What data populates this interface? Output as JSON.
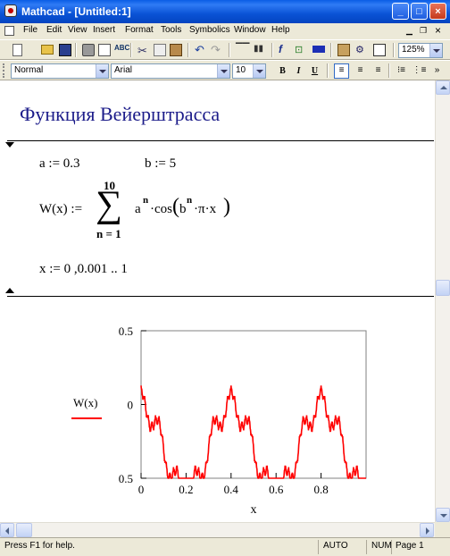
{
  "window": {
    "title": "Mathcad - [Untitled:1]",
    "buttons": {
      "minimize": "_",
      "maximize": "□",
      "close": "×"
    }
  },
  "menu": [
    "File",
    "Edit",
    "View",
    "Insert",
    "Format",
    "Tools",
    "Symbolics",
    "Window",
    "Help"
  ],
  "toolbar": {
    "zoom": "125%"
  },
  "format_toolbar": {
    "style": "Normal",
    "font": "Arial",
    "size": "10",
    "bold": "B",
    "italic": "I",
    "underline": "U"
  },
  "document": {
    "heading": "Функция Вейерштрасса",
    "def_a": "a := 0.3",
    "def_b": "b := 5",
    "w_def": {
      "lhs": "W(x) :=",
      "sum_upper": "10",
      "sum_lower": "n = 1",
      "sigma": "∑",
      "a": "a",
      "a_exp": "n",
      "cos": "·cos",
      "b": "b",
      "b_exp": "n",
      "rest": "·π·x"
    },
    "x_range": "x := 0 ,0.001 .. 1"
  },
  "chart_data": {
    "type": "line",
    "series": [
      {
        "name": "W(x)",
        "color": "#ff0000"
      }
    ],
    "xlabel": "x",
    "ylabel": "",
    "xlim": [
      0,
      1
    ],
    "ylim": [
      -0.5,
      0.5
    ],
    "x_ticks": [
      "0",
      "0.2",
      "0.4",
      "0.6",
      "0.8"
    ],
    "y_ticks": [
      "0.5",
      "0",
      "0.5"
    ],
    "function": {
      "a": 0.3,
      "b": 5,
      "n_from": 1,
      "n_to": 10,
      "x_step": 0.001,
      "y_offset": -0.3
    }
  },
  "status": {
    "help": "Press F1 for help.",
    "mode": "AUTO",
    "num": "NUM",
    "page": "Page 1"
  }
}
